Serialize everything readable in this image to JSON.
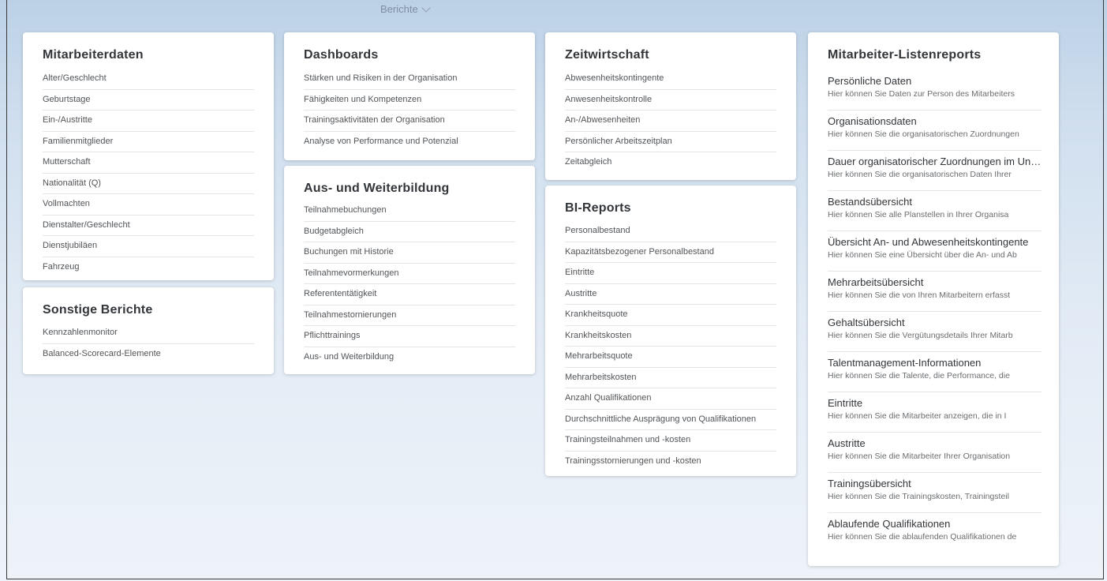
{
  "header": {
    "title": "Berichte"
  },
  "mitarbeiterdaten": {
    "title": "Mitarbeiterdaten",
    "items": [
      "Alter/Geschlecht",
      "Geburtstage",
      "Ein-/Austritte",
      "Familienmitglieder",
      "Mutterschaft",
      "Nationalität (Q)",
      "Vollmachten",
      "Dienstalter/Geschlecht",
      "Dienstjubiläen",
      "Fahrzeug"
    ]
  },
  "sonstige": {
    "title": "Sonstige Berichte",
    "items": [
      "Kennzahlenmonitor",
      "Balanced-Scorecard-Elemente"
    ]
  },
  "dashboards": {
    "title": "Dashboards",
    "items": [
      "Stärken und Risiken in der Organisation",
      "Fähigkeiten und Kompetenzen",
      "Trainingsaktivitäten der Organisation",
      "Analyse von Performance und Potenzial"
    ]
  },
  "weiterbildung": {
    "title": "Aus- und Weiterbildung",
    "items": [
      "Teilnahmebuchungen",
      "Budgetabgleich",
      "Buchungen mit Historie",
      "Teilnahmevormerkungen",
      "Referententätigkeit",
      "Teilnahmestornierungen",
      "Pflichttrainings",
      "Aus- und Weiterbildung"
    ]
  },
  "zeitwirtschaft": {
    "title": "Zeitwirtschaft",
    "items": [
      "Abwesenheitskontingente",
      "Anwesenheitskontrolle",
      "An-/Abwesenheiten",
      "Persönlicher Arbeitszeitplan",
      "Zeitabgleich"
    ]
  },
  "bireports": {
    "title": "BI-Reports",
    "items": [
      "Personalbestand",
      "Kapazitätsbezogener Personalbestand",
      "Eintritte",
      "Austritte",
      "Krankheitsquote",
      "Krankheitskosten",
      "Mehrarbeitsquote",
      "Mehrarbeitskosten",
      "Anzahl Qualifikationen",
      "Durchschnittliche Ausprägung von Qualifikationen",
      "Trainingsteilnahmen und -kosten",
      "Trainingsstornierungen und -kosten"
    ]
  },
  "listenreports": {
    "title": "Mitarbeiter-Listenreports",
    "items": [
      {
        "title": "Persönliche Daten",
        "desc": "Hier können Sie Daten zur Person des Mitarbeiters"
      },
      {
        "title": "Organisationsdaten",
        "desc": "Hier können Sie die organisatorischen Zuordnungen"
      },
      {
        "title": "Dauer organisatorischer Zuordnungen im Unt...",
        "desc": "Hier können Sie die organisatorischen Daten Ihrer"
      },
      {
        "title": "Bestandsübersicht",
        "desc": "Hier können Sie alle Planstellen in Ihrer Organisa"
      },
      {
        "title": "Übersicht An- und Abwesenheitskontingente",
        "desc": "Hier können Sie eine Übersicht über die An- und Ab"
      },
      {
        "title": "Mehrarbeitsübersicht",
        "desc": "Hier können Sie die von Ihren Mitarbeitern erfasst"
      },
      {
        "title": "Gehaltsübersicht",
        "desc": "Hier können Sie die Vergütungsdetails Ihrer Mitarb"
      },
      {
        "title": "Talentmanagement-Informationen",
        "desc": "Hier können Sie die Talente, die Performance, die"
      },
      {
        "title": "Eintritte",
        "desc": "Hier können Sie die Mitarbeiter anzeigen, die in I"
      },
      {
        "title": "Austritte",
        "desc": "Hier können Sie die Mitarbeiter Ihrer Organisation"
      },
      {
        "title": "Trainingsübersicht",
        "desc": "Hier können Sie die Trainingskosten, Trainingsteil"
      },
      {
        "title": "Ablaufende Qualifikationen",
        "desc": "Hier können Sie die ablaufenden Qualifikationen de"
      }
    ]
  }
}
